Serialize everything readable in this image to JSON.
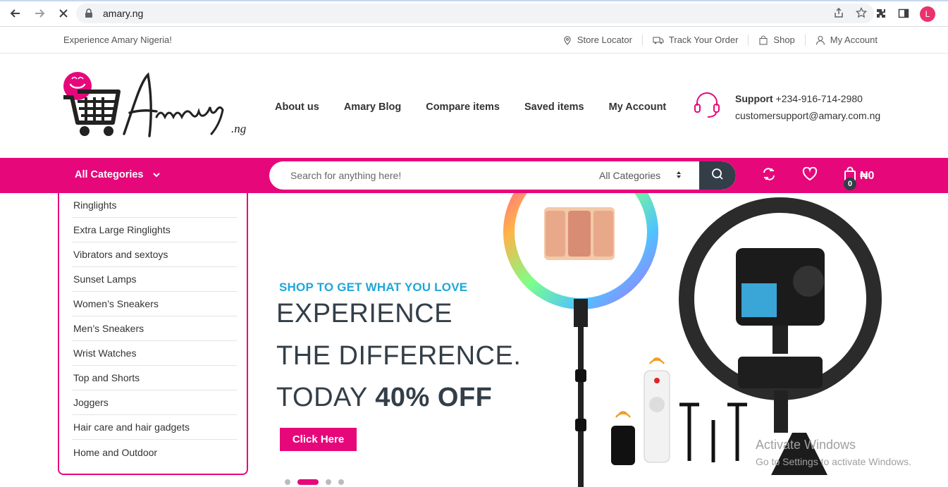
{
  "browser": {
    "url": "amary.ng",
    "profile_initial": "L"
  },
  "topbar": {
    "welcome": "Experience Amary Nigeria!",
    "links": [
      {
        "label": "Store Locator",
        "icon": "map-pin-icon"
      },
      {
        "label": "Track Your Order",
        "icon": "truck-icon"
      },
      {
        "label": "Shop",
        "icon": "shopping-bag-icon"
      },
      {
        "label": "My Account",
        "icon": "user-icon"
      }
    ]
  },
  "logo": {
    "text": "Amary",
    "suffix": ".ng"
  },
  "nav": {
    "items": [
      "About us",
      "Amary Blog",
      "Compare items",
      "Saved items",
      "My Account"
    ]
  },
  "support": {
    "label": "Support",
    "phone": "+234-916-714-2980",
    "email": "customersupport@amary.com.ng"
  },
  "catbar": {
    "all_categories": "All Categories",
    "search_placeholder": "Search for anything here!",
    "search_category": "All Categories",
    "cart_count": "0",
    "cart_total": "₦0"
  },
  "sidebar": {
    "categories": [
      "Ringlights",
      "Extra Large Ringlights",
      "Vibrators and sextoys",
      "Sunset Lamps",
      "Women’s Sneakers",
      "Men’s Sneakers",
      "Wrist Watches",
      "Top and Shorts",
      "Joggers",
      "Hair care and hair gadgets",
      "Home and Outdoor"
    ]
  },
  "hero": {
    "kicker": "SHOP TO GET WHAT YOU LOVE",
    "line1": "EXPERIENCE",
    "line2": "THE DIFFERENCE.",
    "line3_prefix": "TODAY",
    "line3_bold": "40% OFF",
    "cta": "Click Here",
    "slide_count": 4,
    "active_slide": 2
  },
  "watermark": {
    "title": "Activate Windows",
    "subtitle": "Go to Settings to activate Windows."
  },
  "colors": {
    "brand": "#e6087a",
    "dark": "#333e48",
    "kicker": "#1fa7d8"
  }
}
